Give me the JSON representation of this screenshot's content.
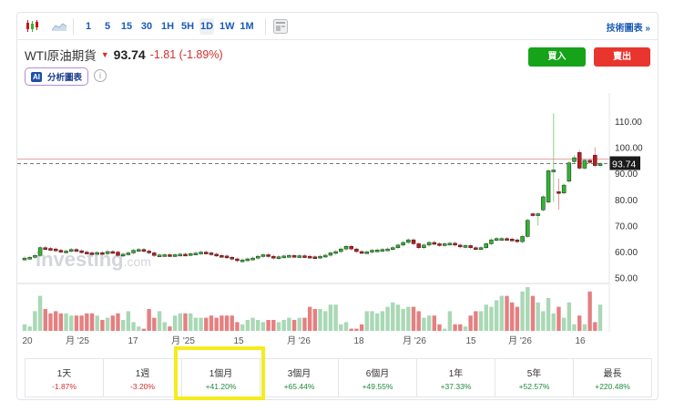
{
  "toolbar": {
    "intervals": [
      "1",
      "5",
      "15",
      "30",
      "1H",
      "5H",
      "1D",
      "1W",
      "1M"
    ],
    "active": "1D",
    "tech_chart_label": "技術圖表 »"
  },
  "instrument": {
    "name": "WTI原油期貨",
    "price": "93.74",
    "change": "-1.81 (-1.89%)",
    "direction_arrow": "▼"
  },
  "ai_button": {
    "badge": "AI",
    "label": "分析圖表"
  },
  "info_icon": "i",
  "buy_label": "買入",
  "sell_label": "賣出",
  "watermark": "investing.com",
  "colors": {
    "up": "#2fb52f",
    "down": "#c4161c",
    "buy": "#16a31a",
    "sell": "#e8352d",
    "link": "#1a5bb5"
  },
  "chart_data": {
    "type": "candlestick",
    "y_ticks": [
      "110.00",
      "100.00",
      "90.00",
      "80.00",
      "70.00",
      "60.00",
      "50.00"
    ],
    "ylim": [
      45,
      118
    ],
    "last_price_label": "93.74",
    "last_price": 93.74,
    "x_labels": [
      "20",
      "月 '25",
      "17",
      "月 '25",
      "15",
      "月 '26",
      "18",
      "月 '26",
      "15",
      "月 '26",
      "16"
    ],
    "closes": [
      57.5,
      57.8,
      58.5,
      61.5,
      61.2,
      61,
      60.5,
      60,
      60.2,
      60.8,
      60.3,
      59.8,
      59.5,
      59.3,
      59.6,
      59.2,
      60,
      59.8,
      58.5,
      59,
      59.5,
      60.5,
      60.8,
      60.2,
      59.5,
      58.5,
      58.7,
      58.8,
      58.5,
      58.8,
      59,
      58.9,
      59.2,
      59.4,
      59.8,
      59.5,
      59,
      58.5,
      58.3,
      57.8,
      57.2,
      56.5,
      56.8,
      57.2,
      57.5,
      58.2,
      58.8,
      58.2,
      57.5,
      58,
      58.3,
      58.5,
      58.2,
      58.4,
      58.2,
      58,
      57.8,
      58.2,
      58.6,
      59.5,
      60,
      61,
      62,
      61,
      60,
      59.8,
      59.9,
      60.5,
      60.6,
      60.8,
      61,
      61.5,
      62.5,
      63.5,
      64.5,
      63,
      61.5,
      62.5,
      63.5,
      63,
      62.5,
      63,
      63.2,
      62.5,
      61.8,
      62.3,
      61.5,
      61.2,
      61.5,
      63,
      64.5,
      65,
      65,
      64.8,
      64.5,
      63.8,
      65.8,
      72,
      74,
      74.5,
      81,
      91,
      91.3,
      82.5,
      85.5,
      94,
      96,
      92,
      95,
      94.2,
      93,
      93.74
    ],
    "opens_override": {
      "98": 74.5,
      "100": 76,
      "101": 79,
      "102": 91,
      "103": 83,
      "105": 87,
      "106": 94.5,
      "107": 98,
      "110": 97
    },
    "highs_override": {
      "102": 113,
      "103": 88,
      "106": 97,
      "107": 99,
      "110": 100
    },
    "lows_override": {
      "102": 79,
      "103": 76,
      "99": 70
    },
    "volumes": [
      3,
      2,
      9,
      16,
      10,
      8,
      9,
      8,
      8,
      7,
      7,
      7,
      8,
      8,
      7,
      5,
      6,
      7,
      8,
      5,
      9,
      4,
      2,
      1,
      10,
      6,
      9,
      4,
      2,
      7,
      8,
      8,
      8,
      6,
      6,
      6,
      7,
      6,
      7,
      7,
      7,
      4,
      3,
      5,
      6,
      5,
      4,
      5,
      5,
      4,
      5,
      6,
      5,
      6,
      6,
      11,
      10,
      10,
      9,
      12,
      12,
      3,
      4,
      1,
      1,
      3,
      9,
      9,
      8,
      9,
      11,
      13,
      12,
      10,
      11,
      11,
      9,
      6,
      7,
      7,
      3,
      1,
      9,
      3,
      3,
      2,
      7,
      9,
      9,
      12,
      11,
      14,
      16,
      16,
      13,
      11,
      18,
      20,
      16,
      13,
      9,
      15,
      8,
      11,
      6,
      13,
      3,
      7,
      3,
      18,
      4,
      12,
      5,
      5,
      9,
      13
    ]
  },
  "periods": [
    {
      "label": "1天",
      "value": "-1.87%",
      "up": false
    },
    {
      "label": "1週",
      "value": "-3.20%",
      "up": false
    },
    {
      "label": "1個月",
      "value": "+41.20%",
      "up": true
    },
    {
      "label": "3個月",
      "value": "+65.44%",
      "up": true
    },
    {
      "label": "6個月",
      "value": "+49.55%",
      "up": true
    },
    {
      "label": "1年",
      "value": "+37.33%",
      "up": true
    },
    {
      "label": "5年",
      "value": "+52.57%",
      "up": true
    },
    {
      "label": "最長",
      "value": "+220.48%",
      "up": true
    }
  ]
}
